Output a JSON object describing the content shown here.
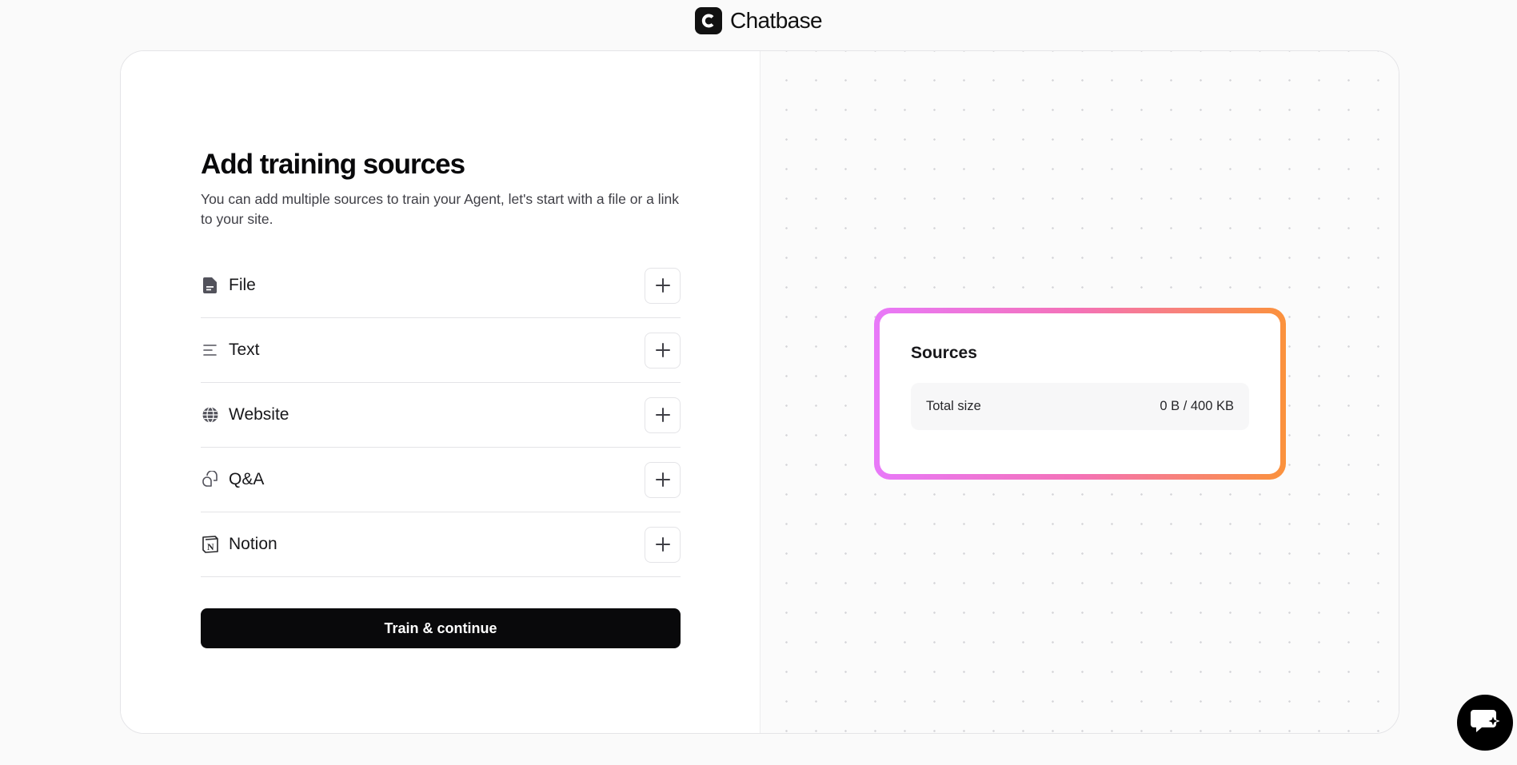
{
  "header": {
    "brand_name": "Chatbase",
    "logo_icon": "chatbase-logo-icon"
  },
  "main": {
    "title": "Add training sources",
    "subtitle": "You can add multiple sources to train your Agent, let's start with a file or a link to your site.",
    "sources": [
      {
        "label": "File",
        "icon": "file-icon"
      },
      {
        "label": "Text",
        "icon": "text-lines-icon"
      },
      {
        "label": "Website",
        "icon": "globe-icon"
      },
      {
        "label": "Q&A",
        "icon": "qa-bubbles-icon"
      },
      {
        "label": "Notion",
        "icon": "notion-icon"
      }
    ],
    "train_button_label": "Train & continue"
  },
  "summary": {
    "title": "Sources",
    "total_size_label": "Total size",
    "total_size_value": "0 B / 400 KB"
  },
  "colors": {
    "accent_dark": "#09090b",
    "gradient_start": "#e879f9",
    "gradient_mid": "#f472b6",
    "gradient_end": "#fb923c"
  },
  "chat_widget": {
    "icon": "chat-widget-icon"
  }
}
